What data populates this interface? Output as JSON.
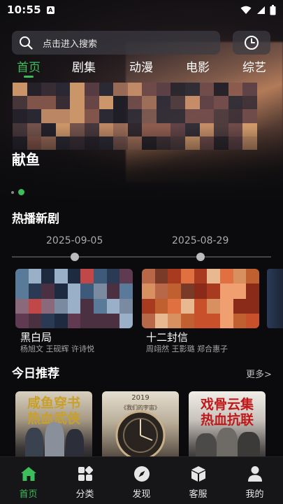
{
  "status_bar": {
    "time": "10:55",
    "notif_letter": "A"
  },
  "search": {
    "placeholder": "点击进入搜索"
  },
  "tabs": [
    {
      "label": "首页",
      "active": true
    },
    {
      "label": "剧集",
      "active": false
    },
    {
      "label": "动漫",
      "active": false
    },
    {
      "label": "电影",
      "active": false
    },
    {
      "label": "综艺",
      "active": false
    }
  ],
  "hero": {
    "title": "献鱼",
    "slide_count": 2,
    "active_slide": 2
  },
  "hot_new": {
    "title": "热播新剧",
    "dates": [
      "2025-09-05",
      "2025-08-29"
    ],
    "items": [
      {
        "title": "黑白局",
        "cast": "杨旭文 王砚辉 许诗悦"
      },
      {
        "title": "十二封信",
        "cast": "周翊然 王影璐 郑合惠子"
      }
    ]
  },
  "today": {
    "title": "今日推荐",
    "more_label": "更多>",
    "posters": [
      {
        "text_lines": [
          "咸鱼穿书",
          "热血武侠"
        ],
        "text_color": "#c9a02a"
      },
      {
        "text_lines": [
          "2019",
          "《我们的宇宙》"
        ],
        "text_color": "#6a4a2a"
      },
      {
        "text_lines": [
          "戏骨云集",
          "热血抗联"
        ],
        "text_color": "#c0181a"
      }
    ]
  },
  "bottom_nav": [
    {
      "label": "首页",
      "icon": "home-icon",
      "active": true
    },
    {
      "label": "分类",
      "icon": "grid-icon",
      "active": false
    },
    {
      "label": "发现",
      "icon": "compass-icon",
      "active": false
    },
    {
      "label": "客服",
      "icon": "box-icon",
      "active": false
    },
    {
      "label": "我的",
      "icon": "person-icon",
      "active": false
    }
  ],
  "colors": {
    "accent": "#3cbe5a",
    "background": "#0b0b0d",
    "nav_bg": "#161618"
  }
}
